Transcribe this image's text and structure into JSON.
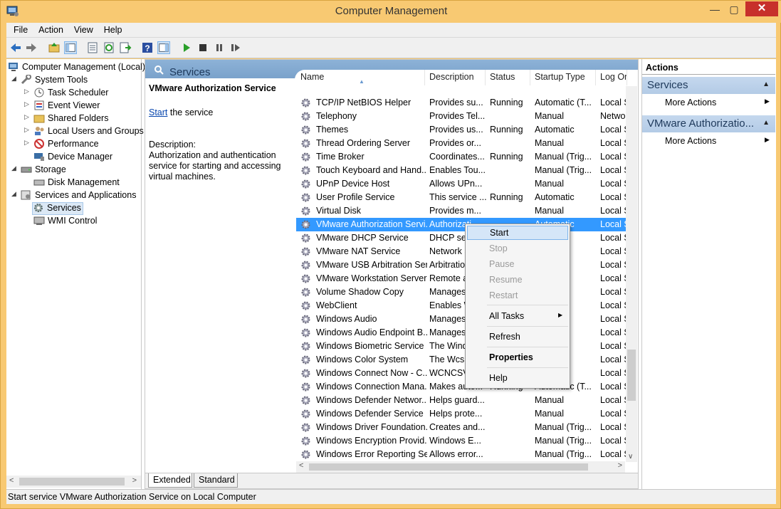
{
  "window": {
    "title": "Computer Management",
    "min": "—",
    "max": "▢",
    "close": "✕"
  },
  "menu": [
    "File",
    "Action",
    "View",
    "Help"
  ],
  "tree": {
    "items": [
      {
        "label": "Computer Management (Local)",
        "level": 0,
        "icon": "computer-icon"
      },
      {
        "label": "System Tools",
        "level": 1,
        "icon": "tools-icon",
        "expanded": true
      },
      {
        "label": "Task Scheduler",
        "level": 2,
        "icon": "clock-icon"
      },
      {
        "label": "Event Viewer",
        "level": 2,
        "icon": "event-viewer-icon"
      },
      {
        "label": "Shared Folders",
        "level": 2,
        "icon": "folder-icon"
      },
      {
        "label": "Local Users and Groups",
        "level": 2,
        "icon": "users-icon"
      },
      {
        "label": "Performance",
        "level": 2,
        "icon": "performance-icon"
      },
      {
        "label": "Device Manager",
        "level": 2,
        "icon": "device-manager-icon"
      },
      {
        "label": "Storage",
        "level": 1,
        "icon": "storage-icon",
        "expanded": true
      },
      {
        "label": "Disk Management",
        "level": 2,
        "icon": "disk-icon"
      },
      {
        "label": "Services and Applications",
        "level": 1,
        "icon": "services-apps-icon",
        "expanded": true
      },
      {
        "label": "Services",
        "level": 2,
        "icon": "gear-icon",
        "selected": true
      },
      {
        "label": "WMI Control",
        "level": 2,
        "icon": "wmi-icon"
      }
    ]
  },
  "services_header": "Services",
  "desc": {
    "title": "VMware Authorization Service",
    "start_link": "Start",
    "start_suffix": " the service",
    "desc_label": "Description:",
    "desc_text": "Authorization and authentication service for starting and accessing virtual machines."
  },
  "columns": [
    "Name",
    "Description",
    "Status",
    "Startup Type",
    "Log On"
  ],
  "rows": [
    [
      "TCP/IP NetBIOS Helper",
      "Provides su...",
      "Running",
      "Automatic (T...",
      "Local S"
    ],
    [
      "Telephony",
      "Provides Tel...",
      "",
      "Manual",
      "Netwo"
    ],
    [
      "Themes",
      "Provides us...",
      "Running",
      "Automatic",
      "Local S"
    ],
    [
      "Thread Ordering Server",
      "Provides or...",
      "",
      "Manual",
      "Local S"
    ],
    [
      "Time Broker",
      "Coordinates...",
      "Running",
      "Manual (Trig...",
      "Local S"
    ],
    [
      "Touch Keyboard and Hand...",
      "Enables Tou...",
      "",
      "Manual (Trig...",
      "Local S"
    ],
    [
      "UPnP Device Host",
      "Allows UPn...",
      "",
      "Manual",
      "Local S"
    ],
    [
      "User Profile Service",
      "This service ...",
      "Running",
      "Automatic",
      "Local S"
    ],
    [
      "Virtual Disk",
      "Provides m...",
      "",
      "Manual",
      "Local S"
    ],
    [
      "VMware Authorization Servi...",
      "Authorizati...",
      "",
      "Automatic",
      "Local S"
    ],
    [
      "VMware DHCP Service",
      "DHCP ser...",
      "",
      "",
      "Local S"
    ],
    [
      "VMware NAT Service",
      "Network a...",
      "",
      "",
      "Local S"
    ],
    [
      "VMware USB Arbitration Ser...",
      "Arbitration...",
      "",
      "",
      "Local S"
    ],
    [
      "VMware Workstation Server",
      "Remote a...",
      "",
      "",
      "Local S"
    ],
    [
      "Volume Shadow Copy",
      "Manages ...",
      "",
      "",
      "Local S"
    ],
    [
      "WebClient",
      "Enables W...",
      "",
      "Trig...",
      "Local S"
    ],
    [
      "Windows Audio",
      "Manages ...",
      "",
      "c",
      "Local S"
    ],
    [
      "Windows Audio Endpoint B...",
      "Manages ...",
      "",
      "c",
      "Local S"
    ],
    [
      "Windows Biometric Service",
      "The Wind...",
      "",
      "",
      "Local S"
    ],
    [
      "Windows Color System",
      "The WcsP...",
      "",
      "",
      "Local S"
    ],
    [
      "Windows Connect Now - C...",
      "WCNCSV...",
      "",
      "",
      "Local S"
    ],
    [
      "Windows Connection Mana...",
      "Makes auto...",
      "Running",
      "Automatic (T...",
      "Local S"
    ],
    [
      "Windows Defender Networ...",
      "Helps guard...",
      "",
      "Manual",
      "Local S"
    ],
    [
      "Windows Defender Service",
      "Helps prote...",
      "",
      "Manual",
      "Local S"
    ],
    [
      "Windows Driver Foundation...",
      "Creates and...",
      "",
      "Manual (Trig...",
      "Local S"
    ],
    [
      "Windows Encryption Provid...",
      "Windows E...",
      "",
      "Manual (Trig...",
      "Local S"
    ],
    [
      "Windows Error Reporting Se...",
      "Allows error...",
      "",
      "Manual (Trig...",
      "Local S"
    ]
  ],
  "selected_row": 9,
  "tabs": [
    "Extended",
    "Standard"
  ],
  "actions": {
    "header": "Actions",
    "sections": [
      {
        "title": "Services",
        "items": [
          "More Actions"
        ]
      },
      {
        "title": "VMware Authorizatio...",
        "items": [
          "More Actions"
        ]
      }
    ]
  },
  "context_menu": {
    "start": "Start",
    "stop": "Stop",
    "pause": "Pause",
    "resume": "Resume",
    "restart": "Restart",
    "all_tasks": "All Tasks",
    "refresh": "Refresh",
    "properties": "Properties",
    "help": "Help"
  },
  "status": "Start service VMware Authorization Service on Local Computer",
  "colors": {
    "titlebar": "#f8c972",
    "selection": "#3399ff",
    "header_blue": "#7aa2cb",
    "close": "#c7302b"
  }
}
